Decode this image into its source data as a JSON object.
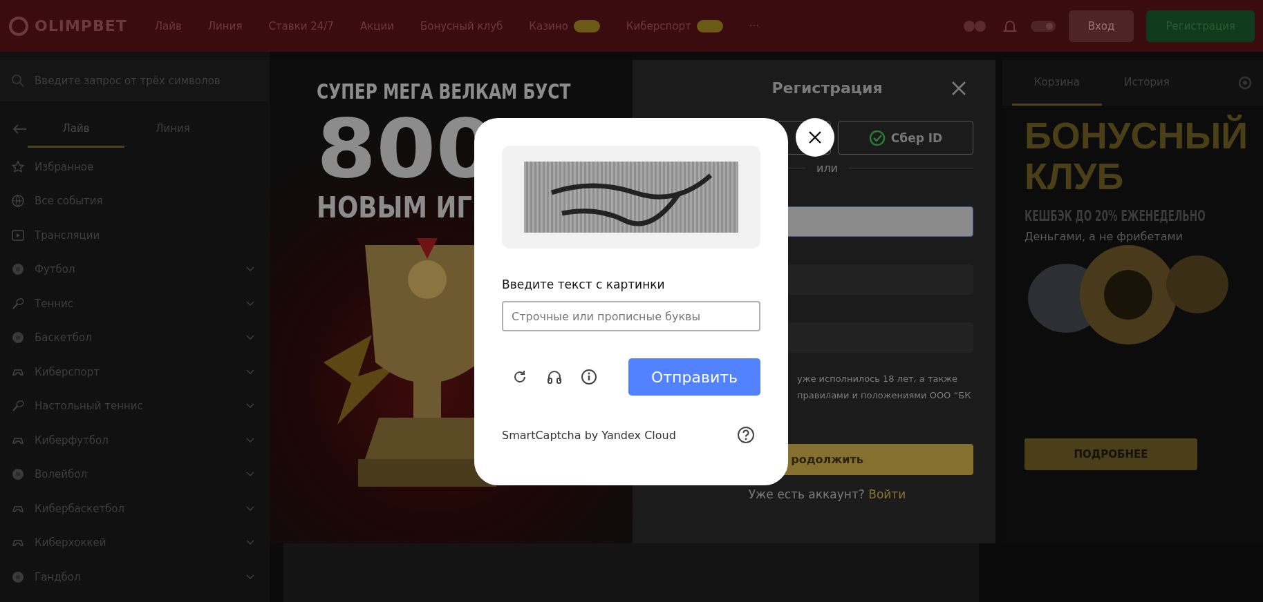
{
  "header": {
    "logo": "OLIMPBET",
    "nav": [
      {
        "label": "Лайв",
        "badge": false
      },
      {
        "label": "Линия",
        "badge": false
      },
      {
        "label": "Ставки 24/7",
        "badge": false
      },
      {
        "label": "Акции",
        "badge": false
      },
      {
        "label": "Бонусный клуб",
        "badge": false
      },
      {
        "label": "Казино",
        "badge": true
      },
      {
        "label": "Киберспорт",
        "badge": true
      },
      {
        "label": "···",
        "badge": false
      }
    ],
    "login": "Вход",
    "register": "Регистрация"
  },
  "sidebar": {
    "search": {
      "placeholder": "Введите запрос от трёх символов"
    },
    "tabs": [
      {
        "label": "Лайв",
        "selected": true
      },
      {
        "label": "Линия",
        "selected": false
      }
    ],
    "items": [
      {
        "name": "Избранное",
        "kind": "star",
        "expandable": false
      },
      {
        "name": "Все события",
        "kind": "globe",
        "expandable": false
      },
      {
        "name": "Трансляции",
        "kind": "screen",
        "expandable": false
      },
      {
        "name": "Футбол",
        "kind": "ball",
        "expandable": true
      },
      {
        "name": "Теннис",
        "kind": "racket",
        "expandable": true
      },
      {
        "name": "Баскетбол",
        "kind": "ball",
        "expandable": true
      },
      {
        "name": "Киберспорт",
        "kind": "gamepad",
        "expandable": true
      },
      {
        "name": "Настольный теннис",
        "kind": "racket",
        "expandable": true
      },
      {
        "name": "Киберфутбол",
        "kind": "gamepad",
        "expandable": true
      },
      {
        "name": "Волейбол",
        "kind": "ball",
        "expandable": true
      },
      {
        "name": "Кибербаскетбол",
        "kind": "gamepad",
        "expandable": true
      },
      {
        "name": "Киберхоккей",
        "kind": "gamepad",
        "expandable": true
      },
      {
        "name": "Гандбол",
        "kind": "ball",
        "expandable": true
      }
    ]
  },
  "promo": {
    "headline": "СУПЕР МЕГА ВЕЛКАМ БУСТ",
    "amount": "800",
    "subline": "НОВЫМ ИГ"
  },
  "registration": {
    "title": "Регистрация",
    "sber": "Сбер ID",
    "divider": "или",
    "fields": [
      {
        "highlighted": true
      },
      {
        "highlighted": false
      },
      {
        "highlighted": false
      }
    ],
    "consent": [
      "уже исполнилось 18 лет, а также",
      "правилами и положениями ООО “БК"
    ],
    "submit": "родолжить",
    "login_prompt": "Уже есть аккаунт?",
    "login_link": "Войти"
  },
  "right_panel": {
    "tabs": [
      {
        "label": "Корзина",
        "selected": true
      },
      {
        "label": "История",
        "selected": false
      }
    ],
    "banner": {
      "title": "БОНУСНЫЙ КЛУБ",
      "subtitle": "КЕШБЭК ДО 20% ЕЖЕНЕДЕЛЬНО",
      "note": "Деньгами, а не фрибетами",
      "button": "ПОДРОБНЕЕ"
    }
  },
  "captcha": {
    "prompt": "Введите текст с картинки",
    "input": {
      "placeholder": "Строчные или прописные буквы"
    },
    "submit": "Отправить",
    "footer": "SmartCaptcha by Yandex Cloud"
  }
}
